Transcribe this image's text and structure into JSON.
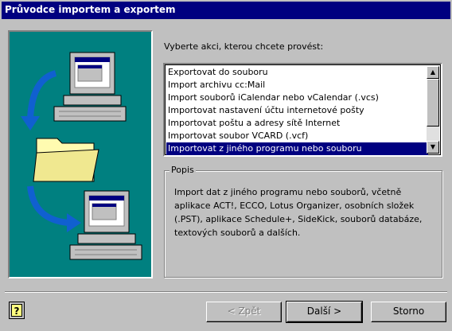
{
  "window": {
    "title": "Průvodce importem a exportem"
  },
  "illustration": {
    "icons": [
      "computer-icon",
      "arrow-icon",
      "folder-icon",
      "arrow-icon",
      "computer-icon"
    ],
    "background": "#008080"
  },
  "prompt": "Vyberte akci, kterou chcete provést:",
  "actions": {
    "items": [
      "Exportovat do souboru",
      "Import archivu cc:Mail",
      "Import souborů iCalendar nebo vCalendar (.vcs)",
      "Importovat nastavení účtu internetové pošty",
      "Importovat poštu a adresy sítě Internet",
      "Importovat soubor VCARD (.vcf)",
      "Importovat z jiného programu nebo souboru"
    ],
    "selected_index": 6
  },
  "description": {
    "legend": "Popis",
    "text": "Import dat z jiného programu nebo souborů, včetně aplikace ACT!, ECCO, Lotus Organizer, osobních složek (.PST), aplikace Schedule+, SideKick, souborů databáze, textových souborů a dalších."
  },
  "buttons": {
    "back": "< Zpět",
    "next": "Další >",
    "cancel": "Storno"
  },
  "colors": {
    "title_bar": "#000080",
    "selection": "#000080",
    "face": "#c0c0c0",
    "desktop": "#008080"
  }
}
